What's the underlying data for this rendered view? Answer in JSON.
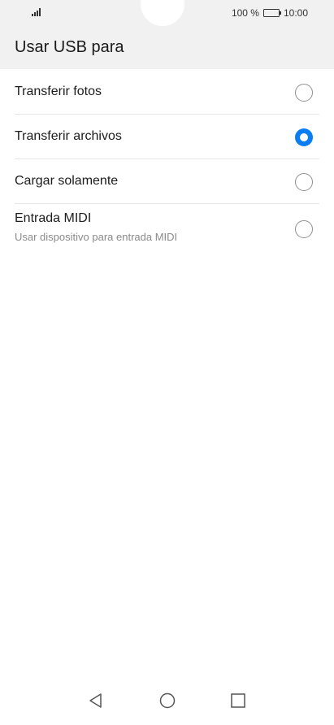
{
  "status_bar": {
    "battery_text": "100 %",
    "time": "10:00"
  },
  "header": {
    "title": "Usar USB para"
  },
  "options": [
    {
      "label": "Transferir fotos",
      "selected": false
    },
    {
      "label": "Transferir archivos",
      "selected": true
    },
    {
      "label": "Cargar solamente",
      "selected": false
    },
    {
      "label": "Entrada MIDI",
      "sublabel": "Usar dispositivo para entrada MIDI",
      "selected": false
    }
  ],
  "colors": {
    "accent": "#0a7df2",
    "header_bg": "#f1f1f1",
    "divider": "#e6e6e6"
  },
  "icons": {
    "signal": "signal-icon",
    "battery": "battery-icon",
    "nav_back": "back-triangle-icon",
    "nav_home": "home-circle-icon",
    "nav_recent": "recent-square-icon"
  }
}
